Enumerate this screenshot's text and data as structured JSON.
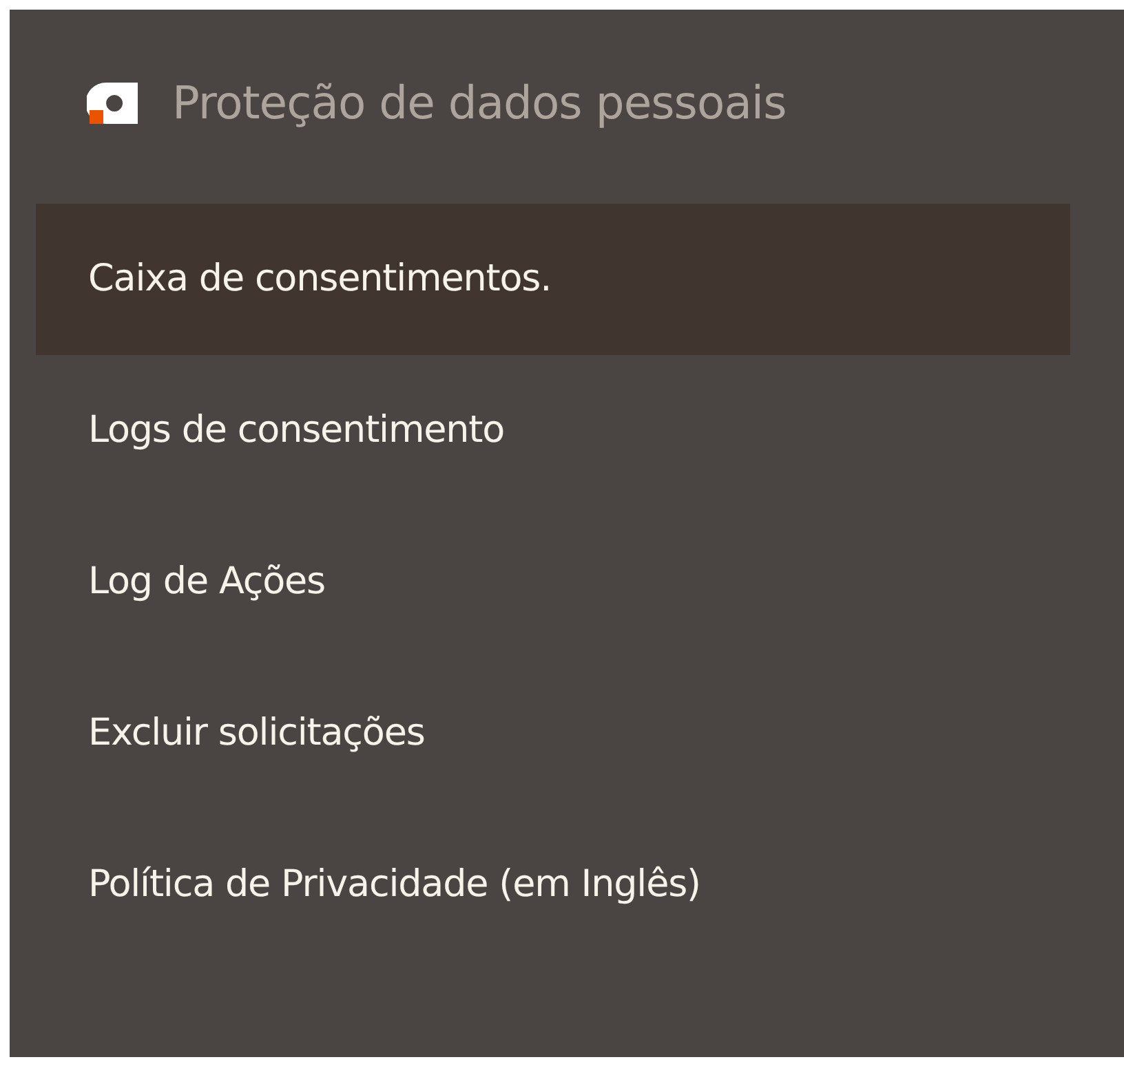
{
  "menu": {
    "title": "Proteção de dados pessoais",
    "items": [
      {
        "label": "Caixa de consentimentos.",
        "selected": true
      },
      {
        "label": "Logs de consentimento",
        "selected": false
      },
      {
        "label": "Log de Ações",
        "selected": false
      },
      {
        "label": "Excluir solicitações",
        "selected": false
      },
      {
        "label": "Política de Privacidade (em Inglês)",
        "selected": false
      }
    ]
  }
}
